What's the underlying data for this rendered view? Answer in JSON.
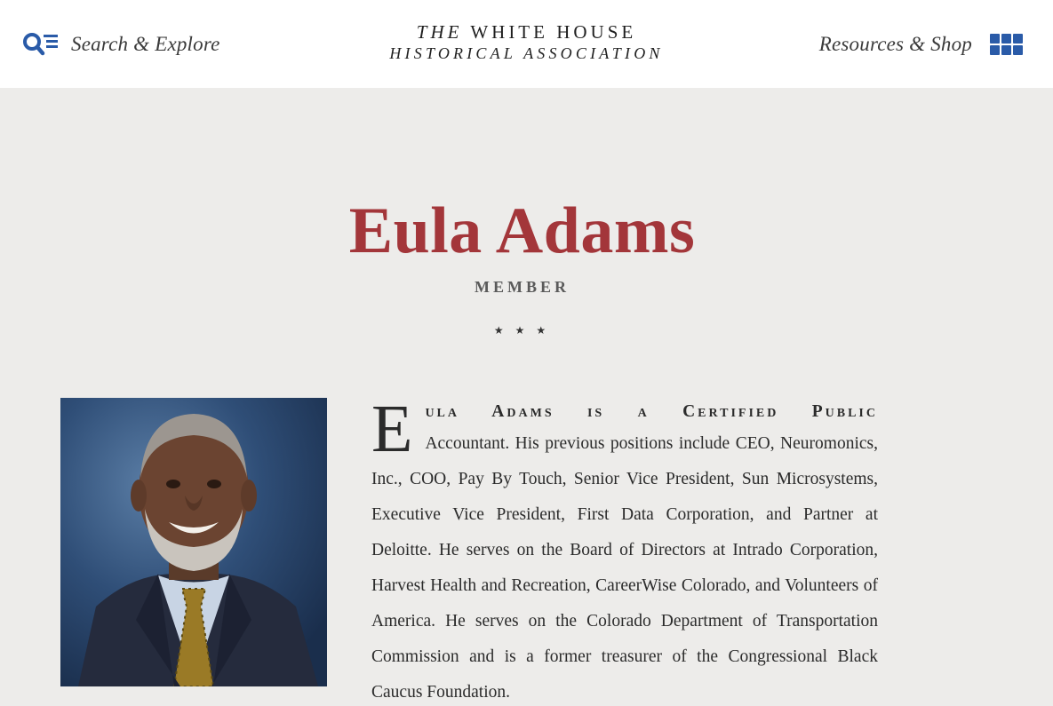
{
  "header": {
    "search_label": "Search & Explore",
    "search_icon": "search-menu-icon",
    "logo_the": "THE",
    "logo_line1": "WHITE HOUSE",
    "logo_line2": "HISTORICAL ASSOCIATION",
    "resources_label": "Resources & Shop",
    "grid_icon": "grid-menu-icon",
    "accent_color": "#2a5ba8"
  },
  "profile": {
    "name": "Eula Adams",
    "role": "MEMBER",
    "divider": "★ ★ ★",
    "name_color": "#a3363a",
    "photo_alt": "Portrait of Eula Adams",
    "bio_dropcap": "E",
    "bio_first": "ula Adams is a Certified Public",
    "bio_rest": "Accountant. His previous positions include CEO, Neuromonics, Inc., COO, Pay By Touch, Senior Vice President, Sun Microsystems, Executive Vice President, First Data Corporation, and Partner at Deloitte. He serves on the Board of Directors at Intrado Corporation, Harvest Health and Recreation, CareerWise Colorado, and Volunteers of America. He serves on the Colorado Department of Transportation Commission and is a former treasurer of the Congressional Black Caucus Foundation."
  }
}
